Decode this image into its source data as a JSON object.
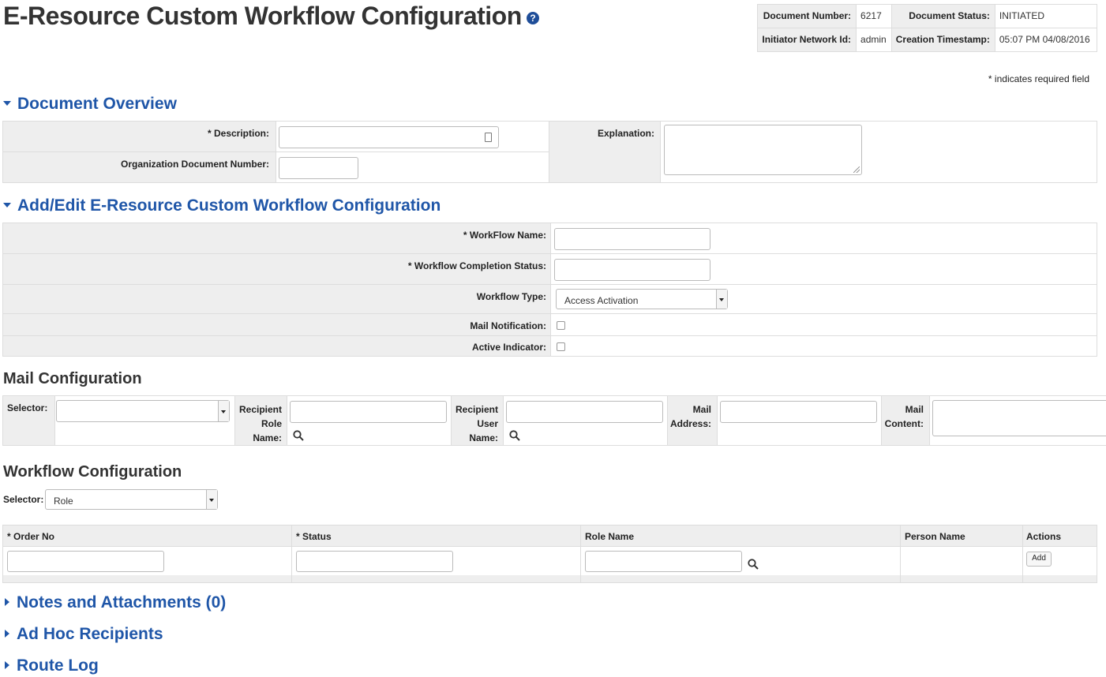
{
  "header": {
    "title": "E-Resource Custom Workflow Configuration",
    "help_icon": "question-circle-icon",
    "required_note": "* indicates required field"
  },
  "doc_info": {
    "document_number_label": "Document Number:",
    "document_number": "6217",
    "document_status_label": "Document Status:",
    "document_status": "INITIATED",
    "initiator_label": "Initiator Network Id:",
    "initiator": "admin",
    "timestamp_label": "Creation Timestamp:",
    "timestamp": "05:07 PM 04/08/2016"
  },
  "document_overview": {
    "title": "Document Overview",
    "description_label": "* Description:",
    "org_doc_number_label": "Organization Document Number:",
    "explanation_label": "Explanation:"
  },
  "add_edit": {
    "title": "Add/Edit E-Resource Custom Workflow Configuration",
    "workflow_name_label": "* WorkFlow Name:",
    "completion_status_label": "* Workflow Completion Status:",
    "workflow_type_label": "Workflow Type:",
    "workflow_type_value": "Access Activation",
    "mail_notification_label": "Mail Notification:",
    "active_indicator_label": "Active Indicator:"
  },
  "mail_config": {
    "title": "Mail Configuration",
    "selector_label": "Selector:",
    "recipient_role_label_1": "Recipient",
    "recipient_role_label_2": "Role",
    "recipient_role_label_3": "Name:",
    "recipient_user_label_1": "Recipient",
    "recipient_user_label_2": "User",
    "recipient_user_label_3": "Name:",
    "mail_address_label_1": "Mail",
    "mail_address_label_2": "Address:",
    "mail_content_label_1": "Mail",
    "mail_content_label_2": "Content:"
  },
  "workflow_config": {
    "title": "Workflow Configuration",
    "selector_label": "Selector:",
    "selector_value": "Role",
    "columns": {
      "order_no": "* Order No",
      "status": "* Status",
      "role_name": "Role Name",
      "person_name": "Person Name",
      "actions": "Actions"
    },
    "add_button": "Add"
  },
  "collapsed_sections": {
    "notes": "Notes and Attachments (0)",
    "adhoc": "Ad Hoc Recipients",
    "route_log": "Route Log"
  }
}
